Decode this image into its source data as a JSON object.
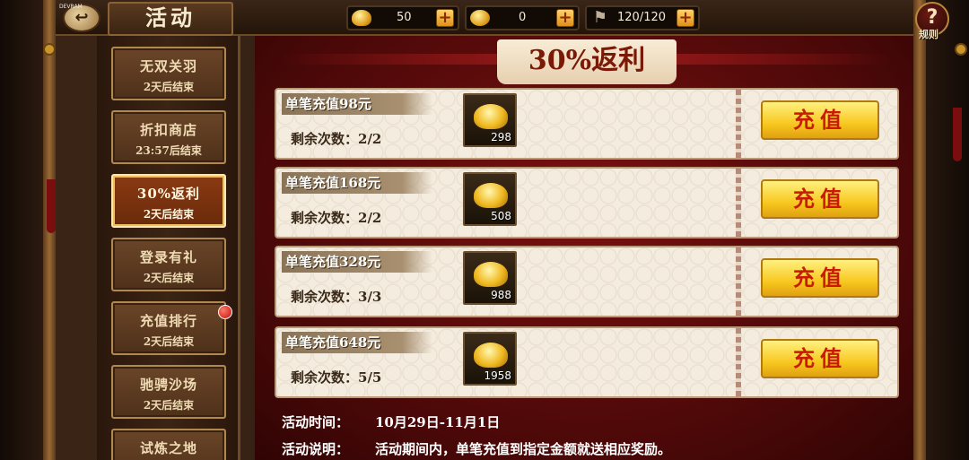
{
  "app": {
    "dev_tag": "DEVRAM",
    "title": "活动"
  },
  "topbar": {
    "back_icon": "back-arrow-icon",
    "resources": [
      {
        "icon": "gold-ingot-icon",
        "value": "50",
        "plus": "+"
      },
      {
        "icon": "coin-icon",
        "value": "0",
        "plus": "+"
      },
      {
        "icon": "flag-icon",
        "value": "120/120",
        "plus": "+"
      }
    ],
    "help_symbol": "?",
    "help_label": "规则"
  },
  "sidebar": {
    "tabs": [
      {
        "name": "无双关羽",
        "sub": "2天后结束",
        "active": false
      },
      {
        "name": "折扣商店",
        "sub": "23:57后结束",
        "active": false
      },
      {
        "name": "30%返利",
        "sub": "2天后结束",
        "active": true
      },
      {
        "name": "登录有礼",
        "sub": "2天后结束",
        "active": false
      },
      {
        "name": "充值排行",
        "sub": "2天后结束",
        "active": false,
        "badge": true
      },
      {
        "name": "驰骋沙场",
        "sub": "2天后结束",
        "active": false
      },
      {
        "name": "试炼之地",
        "sub": "",
        "active": false
      }
    ]
  },
  "main": {
    "banner": "30%返利",
    "rows": [
      {
        "title": "单笔充值98元",
        "remain": "剩余次数：2/2",
        "reward": "298",
        "button": "充值"
      },
      {
        "title": "单笔充值168元",
        "remain": "剩余次数：2/2",
        "reward": "508",
        "button": "充值"
      },
      {
        "title": "单笔充值328元",
        "remain": "剩余次数：3/3",
        "reward": "988",
        "button": "充值"
      },
      {
        "title": "单笔充值648元",
        "remain": "剩余次数：5/5",
        "reward": "1958",
        "button": "充值"
      }
    ],
    "info": {
      "time_label": "活动时间：",
      "time_value": "10月29日-11月1日",
      "desc_label": "活动说明：",
      "desc_value": "活动期间内，单笔充值到指定金额就送相应奖励。"
    }
  },
  "colors": {
    "accent": "#c81a06",
    "gold": "#f8c820",
    "panel": "#4a0808"
  }
}
